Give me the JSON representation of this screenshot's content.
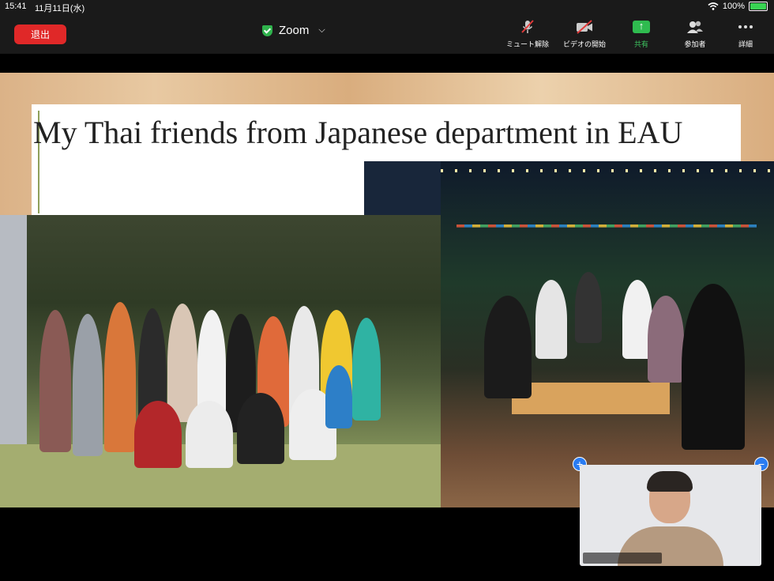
{
  "status_bar": {
    "time": "15:41",
    "date": "11月11日(水)",
    "battery": "100%"
  },
  "toolbar": {
    "leave_label": "退出",
    "meeting_title": "Zoom",
    "tools": [
      {
        "label": "ミュート解除",
        "icon": "muted-mic-icon"
      },
      {
        "label": "ビデオの開始",
        "icon": "video-off-icon"
      },
      {
        "label": "共有",
        "icon": "share-screen-icon"
      },
      {
        "label": "参加者",
        "icon": "participants-icon"
      },
      {
        "label": "詳細",
        "icon": "more-icon"
      }
    ]
  },
  "shared_content": {
    "slide_title": "My Thai friends from Japanese department in EAU"
  },
  "self_view": {
    "expand_label": "+",
    "collapse_label": "−"
  },
  "colors": {
    "leave_red": "#e02828",
    "share_green": "#2fbb4f",
    "toolbar_bg": "#1a1a1a",
    "accent_blue": "#2a7cf2"
  }
}
